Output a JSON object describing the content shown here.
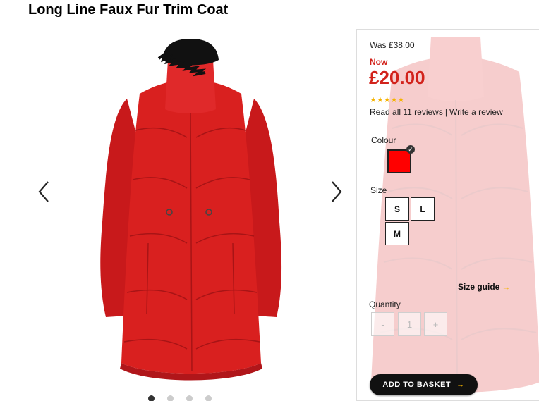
{
  "product": {
    "title": "Long Line Faux Fur Trim Coat"
  },
  "gallery": {
    "slide_count": 4,
    "active_slide": 1
  },
  "pricing": {
    "was": "Was £38.00",
    "now_label": "Now",
    "now_price": "£20.00"
  },
  "rating": {
    "stars": "★★★★★",
    "star_value": 5,
    "read_reviews": "Read all 11 reviews",
    "separator": "|",
    "write_review": "Write a review"
  },
  "colour": {
    "label": "Colour",
    "selected": "#ff0000"
  },
  "size": {
    "label": "Size",
    "options": [
      "S",
      "L",
      "M"
    ]
  },
  "size_guide": {
    "label": "Size guide",
    "arrow": "→"
  },
  "quantity": {
    "label": "Quantity",
    "minus": "-",
    "value": "1",
    "plus": "+"
  },
  "basket": {
    "label": "ADD TO BASKET",
    "arrow": "→"
  },
  "colors": {
    "price_red": "#d2231c",
    "coat_red": "#d9201f",
    "star_gold": "#f5b300"
  }
}
